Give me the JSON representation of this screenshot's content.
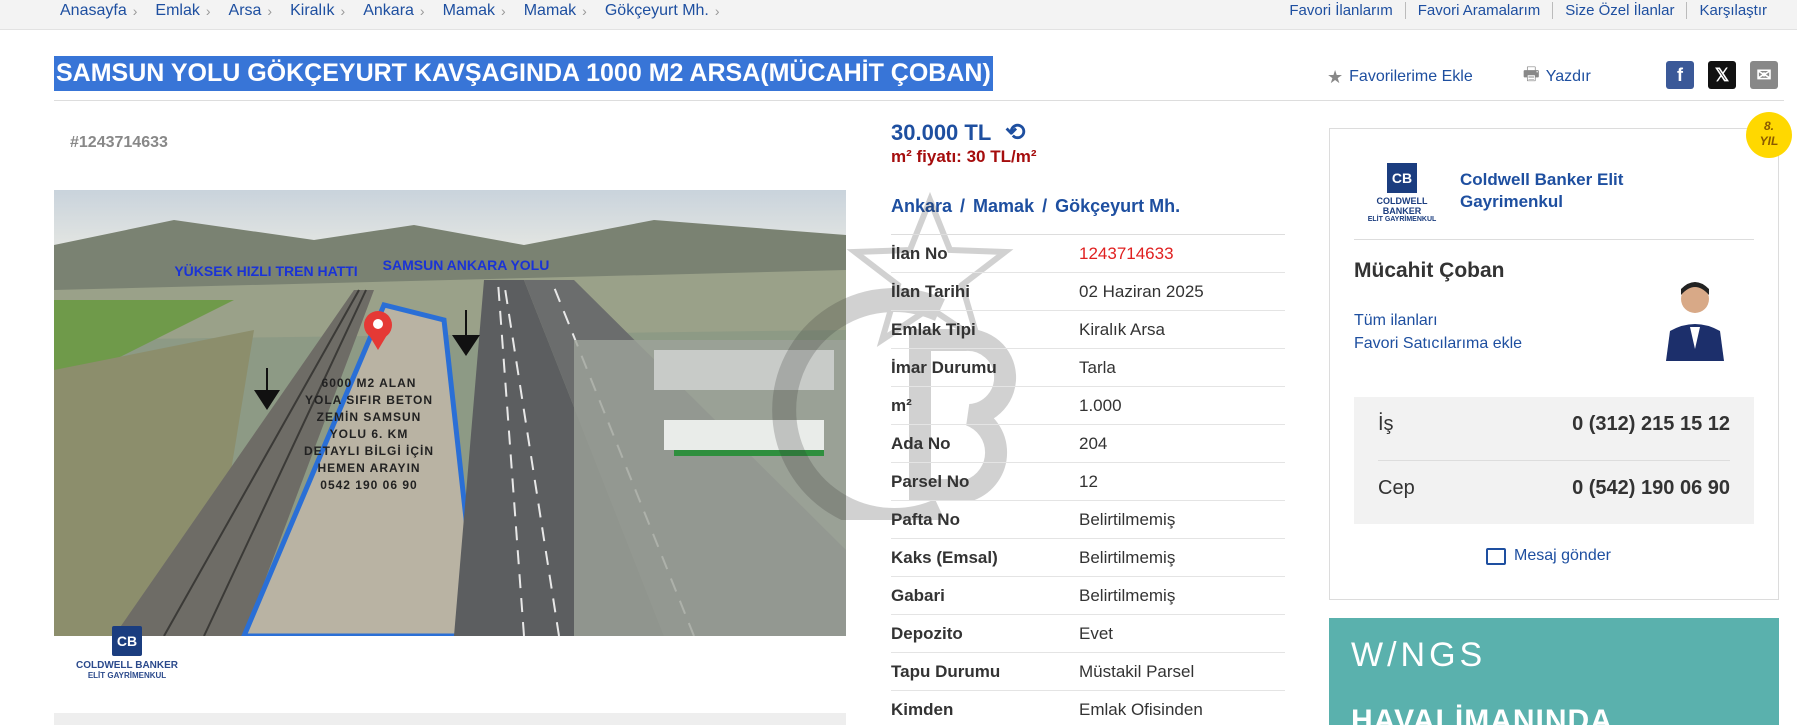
{
  "breadcrumbs": [
    "Anasayfa",
    "Emlak",
    "Arsa",
    "Kiralık",
    "Ankara",
    "Mamak",
    "Mamak",
    "Gökçeyurt Mh."
  ],
  "top_links": [
    "Favori İlanlarım",
    "Favori Aramalarım",
    "Size Özel İlanlar",
    "Karşılaştır"
  ],
  "listing": {
    "title": "SAMSUN YOLU GÖKÇEYURT KAVŞAGINDA 1000 M2 ARSA(MÜCAHİT ÇOBAN)",
    "add_favorite": "Favorilerime Ekle",
    "print": "Yazdır",
    "ad_id": "#1243714633",
    "price": "30.000 TL",
    "m2_price_label": "m² fiyatı:",
    "m2_price_value": "30 TL/m²",
    "location": [
      "Ankara",
      "Mamak",
      "Gökçeyurt Mh."
    ]
  },
  "photo": {
    "label_left": "YÜKSEK HIZLI TREN HATTI",
    "label_right": "SAMSUN ANKARA YOLU",
    "plot_text": "6000 M2 ALAN YOLA SIFIR BETON ZEMİN SAMSUN YOLU 6. KM DETAYLI BİLGİ İÇİN HEMEN ARAYIN 0542 190 06 90",
    "logo_line1": "COLDWELL BANKER",
    "logo_line2": "ELİT GAYRİMENKUL"
  },
  "details": [
    {
      "key": "İlan No",
      "value": "1243714633"
    },
    {
      "key": "İlan Tarihi",
      "value": "02 Haziran 2025"
    },
    {
      "key": "Emlak Tipi",
      "value": "Kiralık Arsa"
    },
    {
      "key": "İmar Durumu",
      "value": "Tarla"
    },
    {
      "key": "m²",
      "value": "1.000"
    },
    {
      "key": "Ada No",
      "value": "204"
    },
    {
      "key": "Parsel No",
      "value": "12"
    },
    {
      "key": "Pafta No",
      "value": "Belirtilmemiş"
    },
    {
      "key": "Kaks (Emsal)",
      "value": "Belirtilmemiş"
    },
    {
      "key": "Gabari",
      "value": "Belirtilmemiş"
    },
    {
      "key": "Depozito",
      "value": "Evet"
    },
    {
      "key": "Tapu Durumu",
      "value": "Müstakil Parsel"
    },
    {
      "key": "Kimden",
      "value": "Emlak Ofisinden"
    }
  ],
  "seller": {
    "badge_years": "8.",
    "badge_label": "YIL",
    "agency_name": "Coldwell Banker Elit Gayrimenkul",
    "logo_line1": "COLDWELL BANKER",
    "logo_line2": "ELİT GAYRİMENKUL",
    "agent_name": "Mücahit Çoban",
    "all_listings": "Tüm ilanları",
    "add_favorite_seller": "Favori Satıcılarıma ekle",
    "phone_work_label": "İş",
    "phone_work": "0 (312) 215 15 12",
    "phone_mobile_label": "Cep",
    "phone_mobile": "0 (542) 190 06 90",
    "message": "Mesaj gönder"
  },
  "banner": {
    "line1": "W/NGS",
    "line2": "HAVALİMANINDA"
  },
  "colors": {
    "link": "#1e4fa0",
    "title_highlight": "#3875d7",
    "price_red": "#a50d0d",
    "ad_no_red": "#e02020",
    "banner": "#5ab1ad"
  }
}
